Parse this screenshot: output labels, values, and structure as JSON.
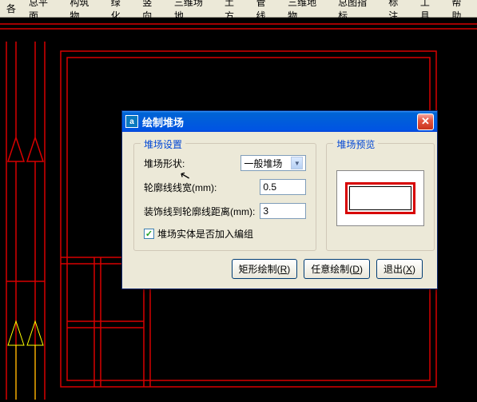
{
  "menu": [
    "各",
    "总平面",
    "构筑物",
    "绿化",
    "竖向",
    "三维场地",
    "土方",
    "管线",
    "三维地物",
    "总图指标",
    "标注",
    "工具",
    "帮助"
  ],
  "dialog": {
    "app_icon_char": "a",
    "title": "绘制堆场",
    "settings_legend": "堆场设置",
    "preview_legend": "堆场预览",
    "shape_label": "堆场形状:",
    "shape_value": "一般堆场",
    "outline_label": "轮廓线线宽(mm):",
    "outline_value": "0.5",
    "decoration_label": "装饰线到轮廓线距离(mm):",
    "decoration_value": "3",
    "checkbox_label": "堆场实体是否加入编组",
    "buttons": {
      "rect": {
        "text": "矩形绘制",
        "key": "R"
      },
      "free": {
        "text": "任意绘制",
        "key": "D"
      },
      "exit": {
        "text": "退出",
        "key": "X"
      }
    }
  }
}
